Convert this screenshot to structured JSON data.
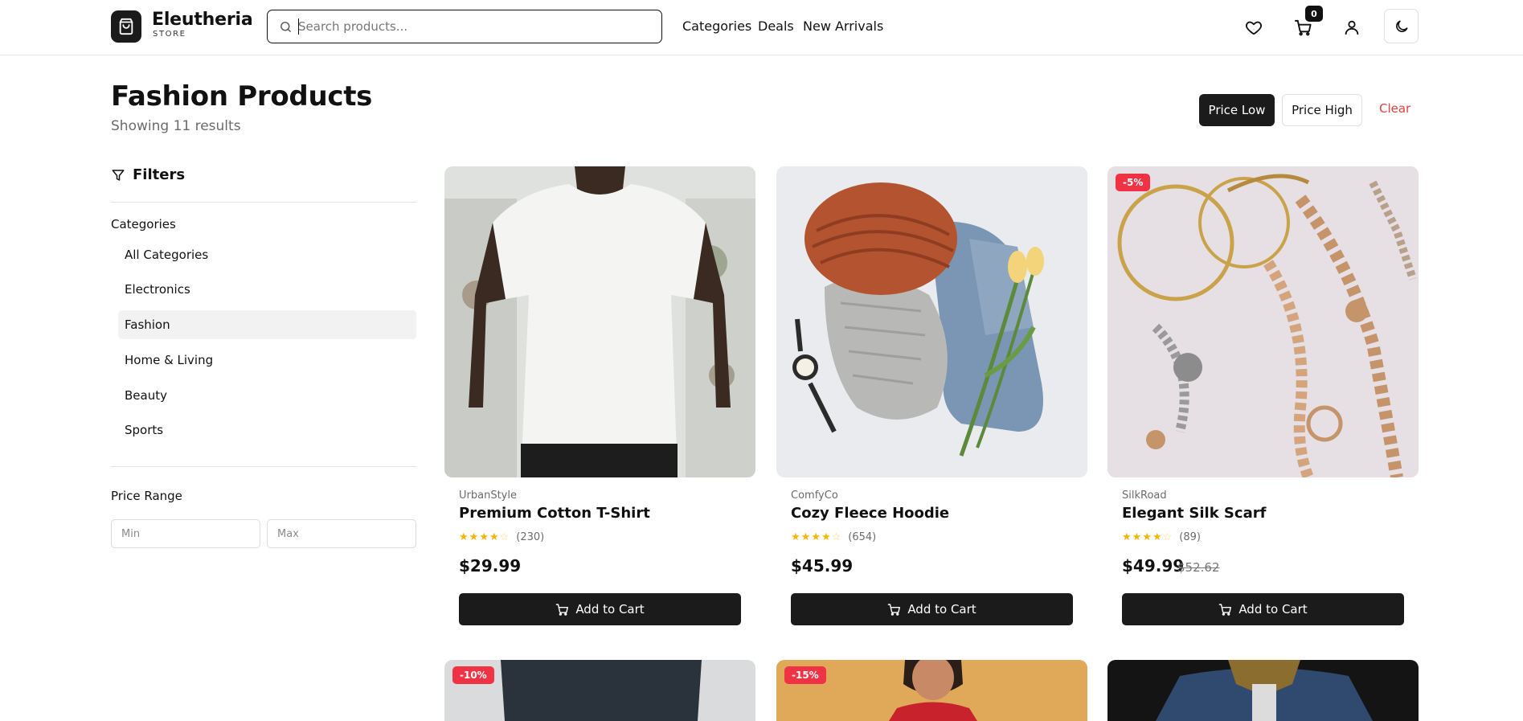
{
  "header": {
    "brand_name": "Eleutheria",
    "brand_sub": "STORE",
    "search_placeholder": "Search products...",
    "search_value": "",
    "nav": [
      "Categories",
      "Deals",
      "New Arrivals"
    ],
    "cart_count": "0"
  },
  "page": {
    "title": "Fashion Products",
    "result_count": "Showing 11 results",
    "sort_low": "Price Low",
    "sort_high": "Price High",
    "clear": "Clear"
  },
  "sidebar": {
    "filters_label": "Filters",
    "categories_label": "Categories",
    "categories": [
      "All Categories",
      "Electronics",
      "Fashion",
      "Home & Living",
      "Beauty",
      "Sports"
    ],
    "active_category": "Fashion",
    "price_range_label": "Price Range",
    "min_placeholder": "Min",
    "max_placeholder": "Max"
  },
  "products": [
    {
      "brand": "UrbanStyle",
      "name": "Premium Cotton T-Shirt",
      "rating": 4,
      "reviews": "(230)",
      "price": "$29.99",
      "old_price": "",
      "badge": "",
      "add_label": "Add to Cart",
      "image": "white-tshirt"
    },
    {
      "brand": "ComfyCo",
      "name": "Cozy Fleece Hoodie",
      "rating": 4,
      "reviews": "(654)",
      "price": "$45.99",
      "old_price": "",
      "badge": "",
      "add_label": "Add to Cart",
      "image": "flatlay-knit-beanie-jeans"
    },
    {
      "brand": "SilkRoad",
      "name": "Elegant Silk Scarf",
      "rating": 4,
      "reviews": "(89)",
      "price": "$49.99",
      "old_price": "$52.62",
      "badge": "-5%",
      "add_label": "Add to Cart",
      "image": "gold-jewelry"
    },
    {
      "badge": "-10%",
      "image": "dark-shorts"
    },
    {
      "badge": "-15%",
      "image": "woman-red-top"
    },
    {
      "badge": "",
      "image": "denim-jacket"
    }
  ],
  "colors": {
    "primary": "#1b1b1b",
    "accent_red": "#ef3344",
    "clear_red": "#e0423a",
    "star": "#f6b400",
    "muted_text": "#6b6b6b"
  }
}
